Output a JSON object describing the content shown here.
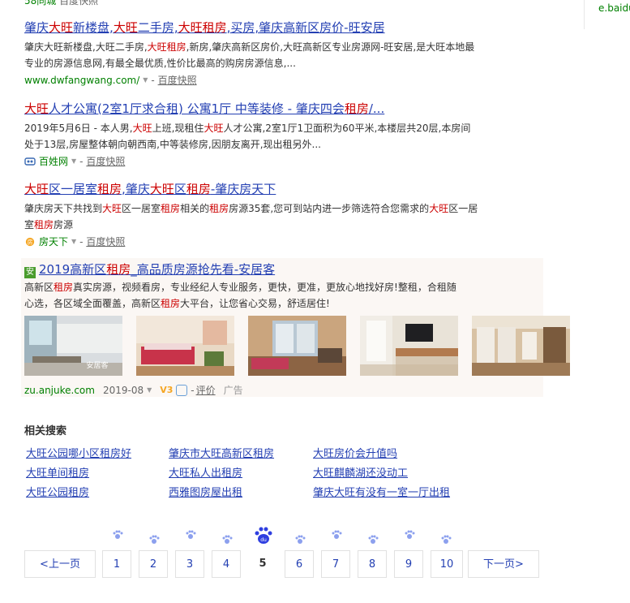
{
  "top_clip": {
    "text": "58同城",
    "snapshot": "百度快照"
  },
  "right_panel": {
    "text": "e.baidu"
  },
  "results": [
    {
      "title_parts": [
        [
          "肇庆",
          false
        ],
        [
          "大旺",
          true
        ],
        [
          "新楼盘,",
          false
        ],
        [
          "大旺",
          true
        ],
        [
          "二手房,",
          false
        ],
        [
          "大旺租房",
          true
        ],
        [
          ",买房,肇庆高新区房价-旺安居",
          false
        ]
      ],
      "abstract_parts": [
        [
          "肇庆大旺新楼盘,大旺二手房,",
          false
        ],
        [
          "大旺租房",
          true
        ],
        [
          ",新房,肇庆高新区房价,大旺高新区专业房源网-旺安居,是大旺本地最专业的房源信息网,有最全最优质,性价比最高的购房房源信息,...",
          false
        ]
      ],
      "url": "www.dwfangwang.com/",
      "snapshot": "百度快照"
    },
    {
      "title_parts": [
        [
          "大旺",
          true
        ],
        [
          "人才公寓(2室1厅求合租) 公寓1厅 中等装修 - 肇庆四会",
          false
        ],
        [
          "租房",
          true
        ],
        [
          "/...",
          false
        ]
      ],
      "abstract_parts": [
        [
          "2019年5月6日 - 本人男,",
          false
        ],
        [
          "大旺",
          true
        ],
        [
          "上班,现租住",
          false
        ],
        [
          "大旺",
          true
        ],
        [
          "人才公寓,2室1厅1卫面积为60平米,本楼层共20层,本房间处于13层,房屋整体朝向朝西南,中等装修房,因朋友离开,现出租另外...",
          false
        ]
      ],
      "source": "百姓网",
      "snapshot": "百度快照"
    },
    {
      "title_parts": [
        [
          "大旺",
          true
        ],
        [
          "区一居室",
          false
        ],
        [
          "租房",
          true
        ],
        [
          ",肇庆",
          false
        ],
        [
          "大旺",
          true
        ],
        [
          "区",
          false
        ],
        [
          "租房",
          true
        ],
        [
          "-肇庆房天下",
          false
        ]
      ],
      "abstract_parts": [
        [
          "肇庆房天下共找到",
          false
        ],
        [
          "大旺",
          true
        ],
        [
          "区一居室",
          false
        ],
        [
          "租房",
          true
        ],
        [
          "相关的",
          false
        ],
        [
          "租房",
          true
        ],
        [
          "房源35套,您可到站内进一步筛选符合您需求的",
          false
        ],
        [
          "大旺",
          true
        ],
        [
          "区一居室",
          false
        ],
        [
          "租房",
          true
        ],
        [
          "房源",
          false
        ]
      ],
      "source": "房天下",
      "snapshot": "百度快照"
    }
  ],
  "ad": {
    "logo": "安",
    "title_parts": [
      [
        "2019高新区",
        false
      ],
      [
        "租房",
        true
      ],
      [
        "_高品质房源抢先看-安居客",
        false
      ]
    ],
    "abstract_parts": [
      [
        "高新区",
        false
      ],
      [
        "租房",
        true
      ],
      [
        "真实房源，视频看房，专业经纪人专业服务，更快，更准，更放心地找好房!整租，合租随心选，各区域全面覆盖，高新区",
        false
      ],
      [
        "租房",
        true
      ],
      [
        "大平台，让您省心交易，舒适居住!",
        false
      ]
    ],
    "url": "zu.anjuke.com",
    "date": "2019-08",
    "badge": "V3",
    "eval": "评价",
    "ad_label": "广告",
    "watermark": "安居客"
  },
  "related": {
    "heading": "相关搜索",
    "items": [
      "大旺公园哪小区租房好",
      "肇庆市大旺高新区租房",
      "大旺房价会升值吗",
      "大旺单间租房",
      "大旺私人出租房",
      "大旺麒麟湖还没动工",
      "大旺公园租房",
      "西雅图房屋出租",
      "肇庆大旺有没有一室一厅出租"
    ]
  },
  "pager": {
    "prev": "<上一页",
    "next": "下一页>",
    "pages": [
      "1",
      "2",
      "3",
      "4",
      "5",
      "6",
      "7",
      "8",
      "9",
      "10"
    ],
    "current": "5",
    "logo_text": "du"
  },
  "colors": {
    "link": "#2440b3",
    "highlight": "#cc0000",
    "url": "#008000"
  }
}
